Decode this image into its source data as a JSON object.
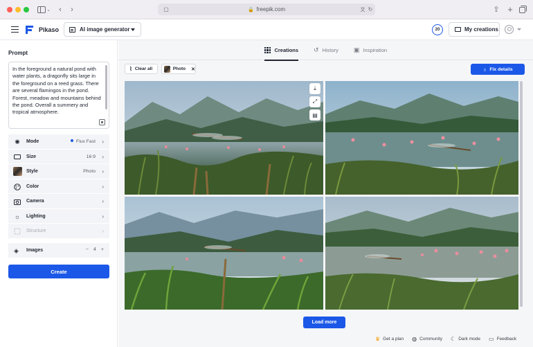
{
  "browser": {
    "url": "freepik.com"
  },
  "app": {
    "brand": "Pikaso",
    "tool_selector": "AI image generator",
    "credits": "20",
    "my_creations": "My creations"
  },
  "prompt": {
    "title": "Prompt",
    "text": "In the foreground a natural pond with water plants, a dragonfly sits large in the foreground on a reed grass. There are several flamingos in the pond. Forest, meadow and mountains behind the pond. Overall a summery and tropical atmosphere."
  },
  "settings": [
    {
      "label": "Mode",
      "value": "Flux Fast",
      "icon": "sparkle-icon"
    },
    {
      "label": "Size",
      "value": "16:9",
      "icon": "aspect-ratio-icon"
    },
    {
      "label": "Style",
      "value": "Photo",
      "icon": "style-thumbnail"
    },
    {
      "label": "Color",
      "value": "",
      "icon": "palette-icon"
    },
    {
      "label": "Camera",
      "value": "",
      "icon": "camera-icon"
    },
    {
      "label": "Lighting",
      "value": "",
      "icon": "sun-icon"
    },
    {
      "label": "Structure",
      "value": "",
      "icon": "structure-icon"
    }
  ],
  "images_setting": {
    "label": "Images",
    "minus": "−",
    "count": "4",
    "plus": "+"
  },
  "create_label": "Create",
  "tabs": [
    {
      "label": "Creations",
      "active": true
    },
    {
      "label": "History",
      "active": false
    },
    {
      "label": "Inspiration",
      "active": false
    }
  ],
  "toolbar": {
    "clear_all": "Clear all",
    "photo_chip": "Photo",
    "fix_details": "Fix details"
  },
  "load_more": "Load more",
  "footer": [
    {
      "label": "Get a plan",
      "icon": "crown-icon"
    },
    {
      "label": "Community",
      "icon": "discord-icon"
    },
    {
      "label": "Dark mode",
      "icon": "moon-icon"
    },
    {
      "label": "Feedback",
      "icon": "chat-icon"
    }
  ],
  "colors": {
    "accent": "#1c58e8",
    "panel_row": "#f3f4f7",
    "main_bg": "#f5f6f8"
  }
}
